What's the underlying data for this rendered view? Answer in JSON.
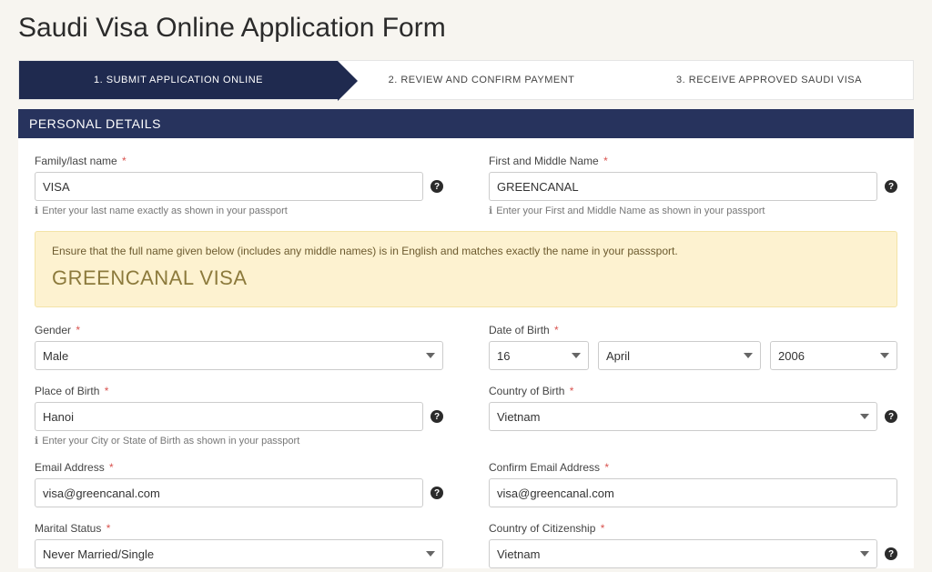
{
  "title": "Saudi Visa Online Application Form",
  "steps": {
    "s1": "1. SUBMIT APPLICATION ONLINE",
    "s2": "2. REVIEW AND CONFIRM PAYMENT",
    "s3": "3. RECEIVE APPROVED SAUDI VISA"
  },
  "section": {
    "personal": "PERSONAL DETAILS"
  },
  "labels": {
    "lastName": "Family/last name",
    "firstName": "First and Middle Name",
    "gender": "Gender",
    "dob": "Date of Birth",
    "pob": "Place of Birth",
    "cob": "Country of Birth",
    "email": "Email Address",
    "confirmEmail": "Confirm Email Address",
    "marital": "Marital Status",
    "citizenship": "Country of Citizenship"
  },
  "hints": {
    "lastName": "Enter your last name exactly as shown in your passport",
    "firstName": "Enter your First and Middle Name as shown in your passport",
    "pob": "Enter your City or State of Birth as shown in your passport"
  },
  "values": {
    "lastName": "VISA",
    "firstName": "GREENCANAL",
    "gender": "Male",
    "dobDay": "16",
    "dobMonth": "April",
    "dobYear": "2006",
    "pob": "Hanoi",
    "cob": "Vietnam",
    "email": "visa@greencanal.com",
    "confirmEmail": "visa@greencanal.com",
    "marital": "Never Married/Single",
    "citizenship": "Vietnam"
  },
  "notice": {
    "text": "Ensure that the full name given below (includes any middle names) is in English and matches exactly the name in your passsport.",
    "fullName": "GREENCANAL VISA"
  },
  "asterisk": "*"
}
